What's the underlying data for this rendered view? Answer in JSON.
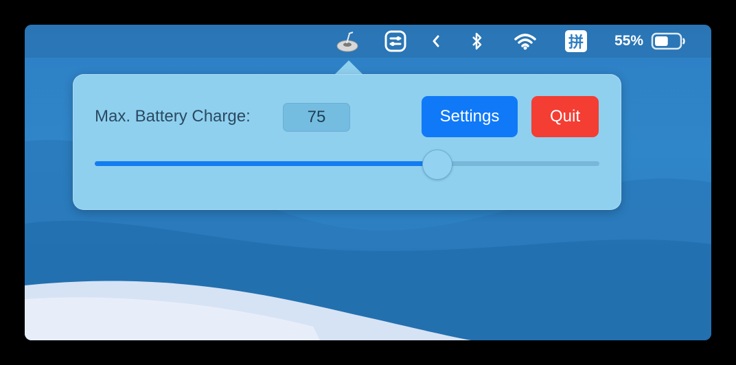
{
  "menubar": {
    "app_icon": "aldente-icon",
    "items": [
      "control-center-icon",
      "chevron-left-icon",
      "bluetooth-icon",
      "wifi-icon",
      "input-method-icon"
    ],
    "input_method_glyph": "拼",
    "battery_percent": "55%",
    "battery_level": 0.55
  },
  "popover": {
    "label": "Max. Battery Charge:",
    "value": "75",
    "settings_label": "Settings",
    "quit_label": "Quit",
    "slider_value": 75,
    "slider_min": 0,
    "slider_max": 100
  },
  "colors": {
    "accent": "#1079f8",
    "quit": "#f43d33",
    "popover_bg": "#8fd0ef"
  }
}
